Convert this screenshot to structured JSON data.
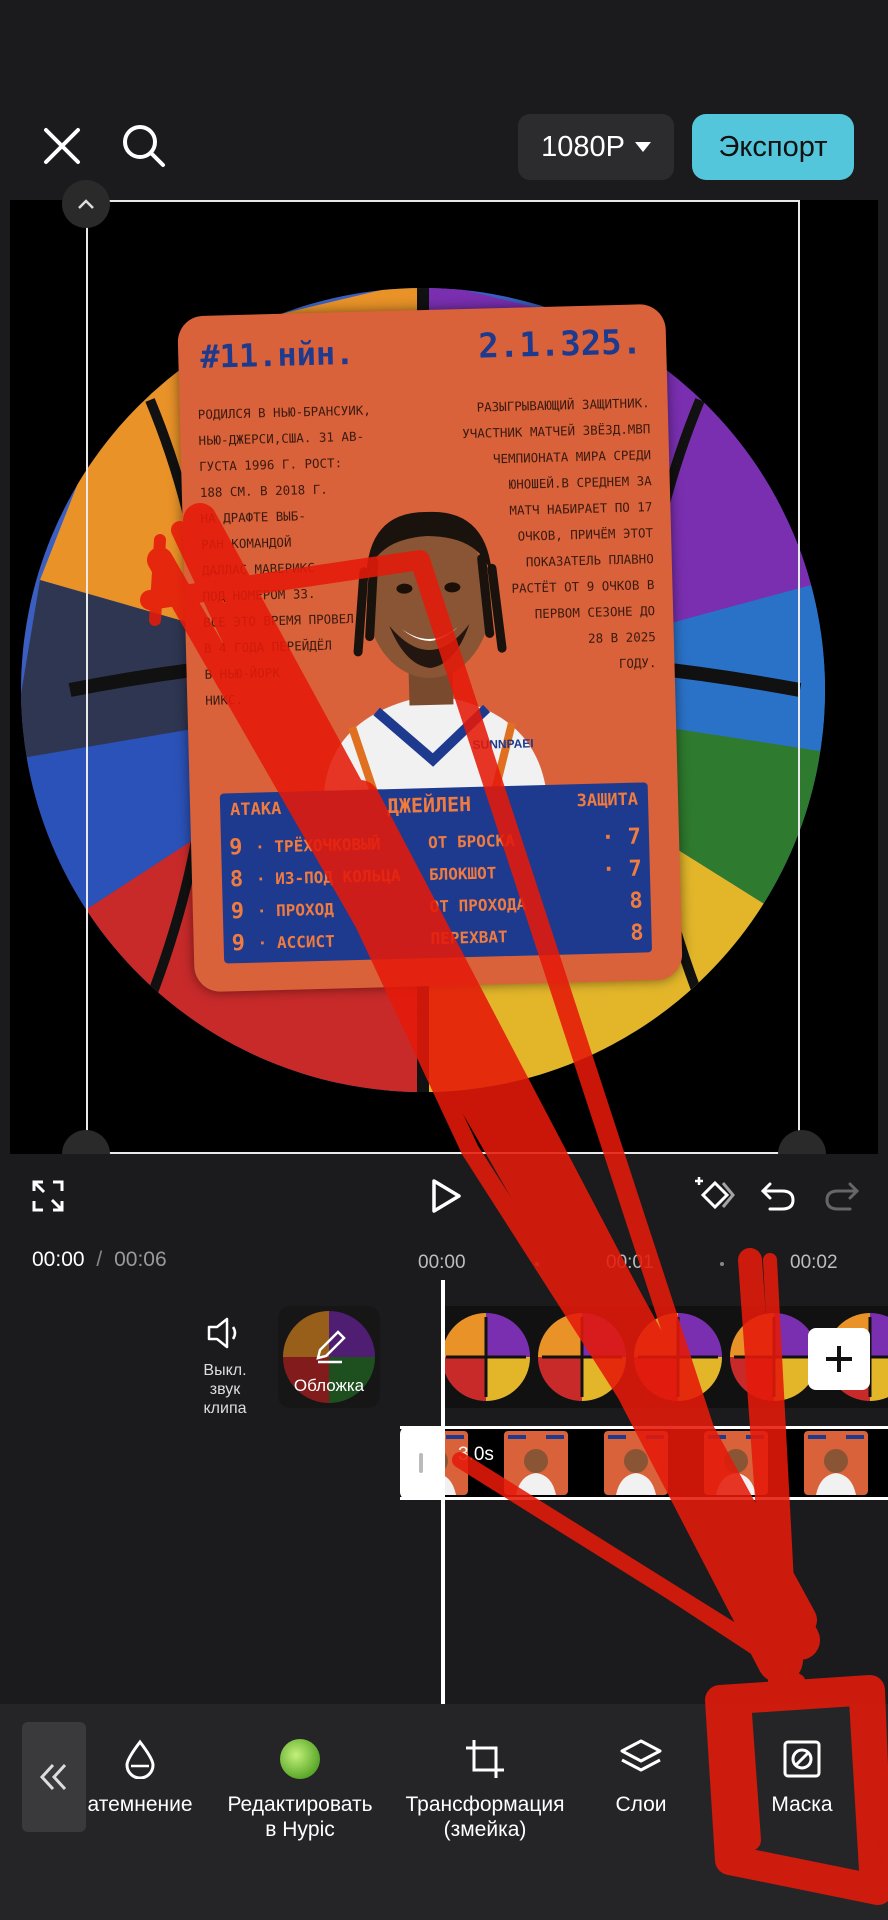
{
  "header": {
    "resolution": "1080P",
    "export_label": "Экспорт"
  },
  "card": {
    "number": "#11.нйн.",
    "stats_code": "2.1.325.",
    "bio_left": [
      "РОДИЛСЯ В НЬЮ-БРАНСУИК,",
      "НЬЮ-ДЖЕРСИ,США. 31 АВ-",
      "ГУСТА 1996 Г. РОСТ:",
      "188 СМ. В 2018 Г.",
      "НА ДРАФТЕ ВЫБ-",
      "РАН КОМАНДОЙ",
      "ДАЛЛАС МАВЕРИКС",
      "ПОД НОМЕРОМ 33.",
      "ВСЕ ЭТО ВРЕМЯ ПРОВЕЛ",
      "В 4 ГОДА ПЕРЕЙДЁЛ",
      "В НЬЮ-ЙОРК",
      "НИКС."
    ],
    "bio_right": [
      "РАЗЫГРЫВАЮЩИЙ ЗАЩИТНИК.",
      "УЧАСТНИК МАТЧЕЙ ЗВЁЗД.МВП",
      "ЧЕМПИОНАТА МИРА СРЕДИ",
      "ЮНОШЕЙ.В СРЕДНЕМ ЗА",
      "МАТЧ НАБИРАЕТ ПО 17",
      "ОЧКОВ, ПРИЧЁМ ЭТОТ",
      "ПОКАЗАТЕЛЬ ПЛАВНО",
      "РАСТЁТ ОТ 9 ОЧКОВ В",
      "ПЕРВОМ СЕЗОНЕ ДО",
      "28 В 2025",
      "ГОДУ."
    ],
    "jersey_brand": "SUNNPAEI",
    "attack_label": "АТАКА",
    "name_label": "ДЖЕЙЛЕН",
    "defense_label": "ЗАЩИТА",
    "rows": [
      {
        "a_val": "9",
        "a_txt": "· ТРЁХОЧКОВЫЙ",
        "d_txt": "ОТ БРОСКА",
        "d_val": "· 7"
      },
      {
        "a_val": "8",
        "a_txt": "· ИЗ-ПОД КОЛЬЦА",
        "d_txt": "БЛОКШОТ",
        "d_val": "· 7"
      },
      {
        "a_val": "9",
        "a_txt": "· ПРОХОД",
        "d_txt": "ОТ ПРОХОДА",
        "d_val": "8"
      },
      {
        "a_val": "9",
        "a_txt": "· АССИСТ",
        "d_txt": "ПЕРЕХВАТ",
        "d_val": "8"
      }
    ]
  },
  "playback": {
    "current_time": "00:00",
    "separator": "/",
    "total_time": "00:06",
    "ruler": [
      "00:00",
      "00:01",
      "00:02"
    ]
  },
  "timeline": {
    "mute_label": "Выкл.\nзвук\nклипа",
    "cover_label": "Обложка",
    "clip_duration": "3.0s"
  },
  "toolbar": {
    "items": [
      {
        "label": "атемнение",
        "icon": "drop-icon"
      },
      {
        "label": "Редактировать\nв Hypic",
        "icon": "hypic-icon"
      },
      {
        "label": "Трансформация\n(змейка)",
        "icon": "crop-icon"
      },
      {
        "label": "Слои",
        "icon": "layers-icon"
      },
      {
        "label": "Маска",
        "icon": "mask-icon"
      }
    ]
  },
  "colors": {
    "accent": "#53c6dc",
    "card_orange": "#d9623a",
    "card_blue": "#1d3a8f",
    "annotation_red": "#e51a0a"
  }
}
